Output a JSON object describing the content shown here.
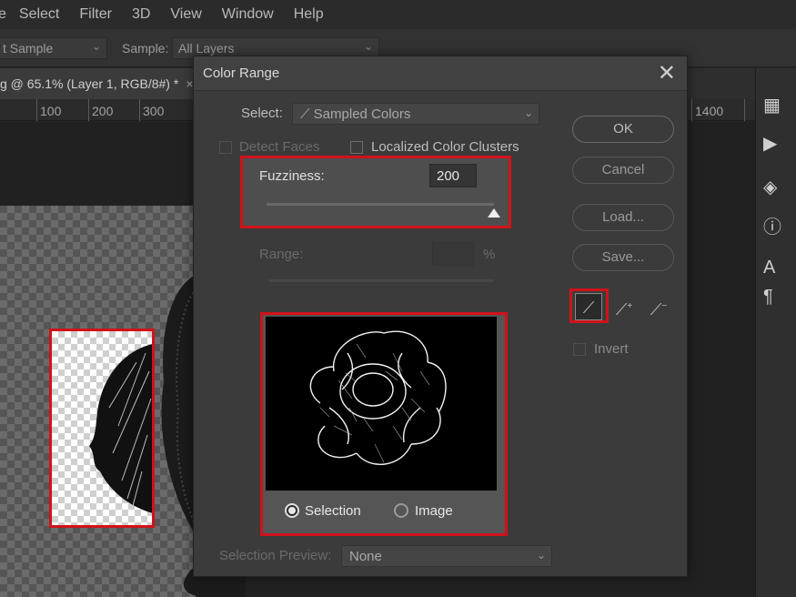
{
  "menubar": {
    "items": [
      "e",
      "Select",
      "Filter",
      "3D",
      "View",
      "Window",
      "Help"
    ]
  },
  "options_bar": {
    "sample_size": "t Sample",
    "sample_label": "Sample:",
    "sample_value": "All Layers"
  },
  "document_tab": {
    "title": "g @ 65.1% (Layer 1, RGB/8#) *",
    "close": "×"
  },
  "ruler": {
    "ticks": [
      "100",
      "200",
      "300",
      "1400"
    ]
  },
  "dialog": {
    "title": "Color Range",
    "close": "✕",
    "select_label": "Select:",
    "select_value": "Sampled Colors",
    "detect_faces_label": "Detect Faces",
    "localized_label": "Localized Color Clusters",
    "fuzziness_label": "Fuzziness:",
    "fuzziness_value": "200",
    "range_label": "Range:",
    "range_unit": "%",
    "selection_label": "Selection",
    "image_label": "Image",
    "selection_preview_label": "Selection Preview:",
    "selection_preview_value": "None",
    "buttons": {
      "ok": "OK",
      "cancel": "Cancel",
      "load": "Load...",
      "save": "Save..."
    },
    "invert_label": "Invert"
  },
  "colors": {
    "highlight": "#d0121a",
    "dialog_bg": "#3b3b3b"
  },
  "icons": [
    "eyedropper-icon",
    "eyedropper-plus-icon",
    "eyedropper-minus-icon",
    "close-icon",
    "chevron-down-icon"
  ]
}
